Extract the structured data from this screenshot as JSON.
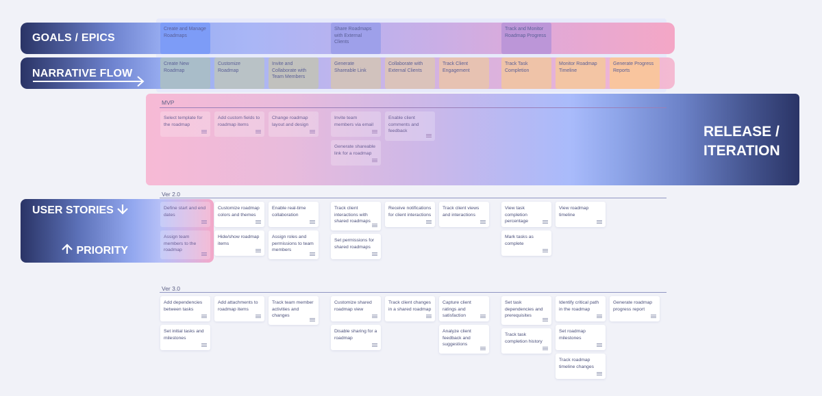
{
  "bands": {
    "goals_label": "GOALS / EPICS",
    "narrative_label": "NARRATIVE FLOW",
    "release_label_line1": "RELEASE /",
    "release_label_line2": "ITERATION",
    "user_stories_label": "USER STORIES",
    "priority_label": "PRIORITY"
  },
  "goals": [
    {
      "label": "Create and Manage Roadmaps",
      "color": "#7d9cf7"
    },
    {
      "label": "Share Roadmaps with External Clients",
      "color": "#9ea0ea"
    },
    {
      "label": "Track and Monitor Roadmap Progress",
      "color": "#bc96d8"
    }
  ],
  "narrative": [
    {
      "label": "Create New Roadmap",
      "color": "#a9bdc9"
    },
    {
      "label": "Customize Roadmap",
      "color": "#b9c2c6"
    },
    {
      "label": "Invite and Collaborate with Team Members",
      "color": "#c1c1be"
    },
    {
      "label": "Generate Shareable Link",
      "color": "#d1c2bd"
    },
    {
      "label": "Collaborate with External Clients",
      "color": "#dbc3bb"
    },
    {
      "label": "Track Client Engagement",
      "color": "#e7c2b2"
    },
    {
      "label": "Track Task Completion",
      "color": "#efc3a8"
    },
    {
      "label": "Monitor Roadmap Timeline",
      "color": "#f3c5a4"
    },
    {
      "label": "Generate Progress Reports",
      "color": "#f9c59e"
    }
  ],
  "releases": {
    "mvp": {
      "title": "MVP",
      "cards": [
        "Select template for the roadmap",
        "Add custom fields to roadmap items",
        "Change roadmap layout and design",
        "Invite team members via email",
        "Generate shareable link for a roadmap",
        "Enable client comments and feedback"
      ]
    },
    "v2": {
      "title": "Ver 2.0",
      "cards": [
        "Define start and end dates",
        "Assign team members to the roadmap",
        "Customize roadmap colors and themes",
        "Hide/show roadmap items",
        "Enable real-time collaboration",
        "Assign roles and permissions to team members",
        "Track client interactions with shared roadmaps",
        "Set permissions for shared roadmaps",
        "Receive notifications for client interactions",
        "Track client views and interactions",
        "View task completion percentage",
        "Mark tasks as complete",
        "View roadmap timeline"
      ]
    },
    "v3": {
      "title": "Ver 3.0",
      "cards": [
        "Add dependencies between tasks",
        "Set initial tasks and milestones",
        "Add attachments to roadmap items",
        "Track team member activities and changes",
        "Customize shared roadmap view",
        "Disable sharing for a roadmap",
        "Track client changes in a shared roadmap",
        "Capture client ratings and satisfaction",
        "Analyze client feedback and suggestions",
        "Set task dependencies and prerequisites",
        "Track task completion history",
        "Identify critical path in the roadmap",
        "Set roadmap milestones",
        "Track roadmap timeline changes",
        "Generate roadmap progress report"
      ]
    }
  }
}
